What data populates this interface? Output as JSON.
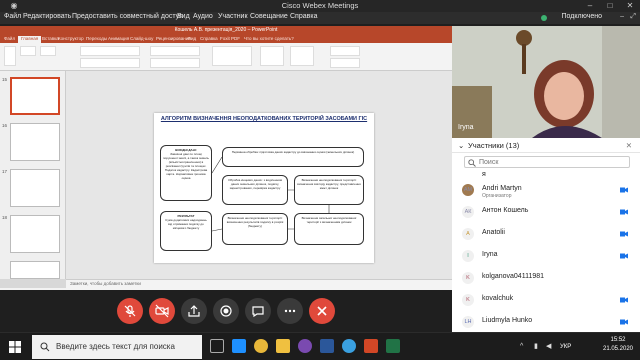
{
  "window": {
    "title": "Cisco Webex Meetings"
  },
  "menu": [
    "Файл",
    "Редактировать",
    "Предоставить совместный доступ",
    "Вид",
    "Аудио",
    "Участник",
    "Совещание",
    "Справка"
  ],
  "status": {
    "connected_label": "Подключено",
    "color": "#3cb371"
  },
  "powerpoint": {
    "title": "Кошель А.В. презентація_2020 – PowerPoint",
    "tabs": [
      "Файл",
      "Главная",
      "Вставка",
      "Конструктор",
      "Переходы",
      "Анимация",
      "Слайд-шоу",
      "Рецензирование",
      "Вид",
      "Справка",
      "Foxit PDF",
      "Что вы хотите сделать?"
    ],
    "slide": {
      "title": "АЛГОРИТМ ВИЗНАЧЕННЯ НЕОПОДАТКОВАНИХ ТЕРИТОРІЙ ЗАСОБАМИ ГІС",
      "boxes": {
        "input_title": "ВИХІДНІ ДАНІ:",
        "input_text": "Зовнішні дані по площі порушеної землі, а також земель (кількість/ограничення) в розсіканні ґрунтів та площах. Податок кадастру. Кадастрова карта. Нормативна грошова оцінка",
        "op1": "Первинна обробка: підготовка даних кадастру до виконання оцінки (земельних ділянок)",
        "op2": "Обробка кінцевих даних: з виділенням даних земельних ділянок, податку, зареєстрованих, перевірка кадастру",
        "op3": "Визначення неоподаткованої території: визначення вигляду кадастру, представлення меж і ділянок",
        "op4": "Визначення неоподаткованої території: визначення результатів податку в розрізі (бюджету)",
        "op5": "Визначення загальної неоподаткованої території з визначенням ділянок",
        "result_title": "РЕЗУЛЬТАТ",
        "result_text": "Сума додаткових надходжень від отримання податку до місцевого бюджету"
      }
    },
    "notes_placeholder": "Заметки, чтобы добавить заметки",
    "status_left": "Слайд 15 из 21",
    "status_lang": "українська",
    "status_right": "Заметки    Примечания"
  },
  "toolbar": {
    "buttons": [
      "mute",
      "stop-video",
      "share",
      "record",
      "chat",
      "more",
      "leave"
    ]
  },
  "video": {
    "name": "Iryna"
  },
  "participants": {
    "header": "Участники (13)",
    "search_placeholder": "Поиск",
    "list": [
      {
        "initials": "",
        "name": "я",
        "sub": "",
        "video": false
      },
      {
        "initials": "AM",
        "name": "Andri Martyn",
        "sub": "Организатор",
        "video": true
      },
      {
        "initials": "АК",
        "name": "Антон Кошель",
        "sub": "",
        "video": true
      },
      {
        "initials": "A",
        "name": "Anatolii",
        "sub": "",
        "video": true
      },
      {
        "initials": "I",
        "name": "Iryna",
        "sub": "",
        "video": true
      },
      {
        "initials": "K",
        "name": "kolganova04111981",
        "sub": "",
        "video": false
      },
      {
        "initials": "K",
        "name": "kovalchuk",
        "sub": "",
        "video": true
      },
      {
        "initials": "LH",
        "name": "Liudmyla Hunko",
        "sub": "",
        "video": true
      }
    ]
  },
  "taskbar": {
    "search_text": "Введите здесь текст для поиска",
    "lang": "УКР",
    "time": "15:52",
    "date": "21.05.2020"
  }
}
